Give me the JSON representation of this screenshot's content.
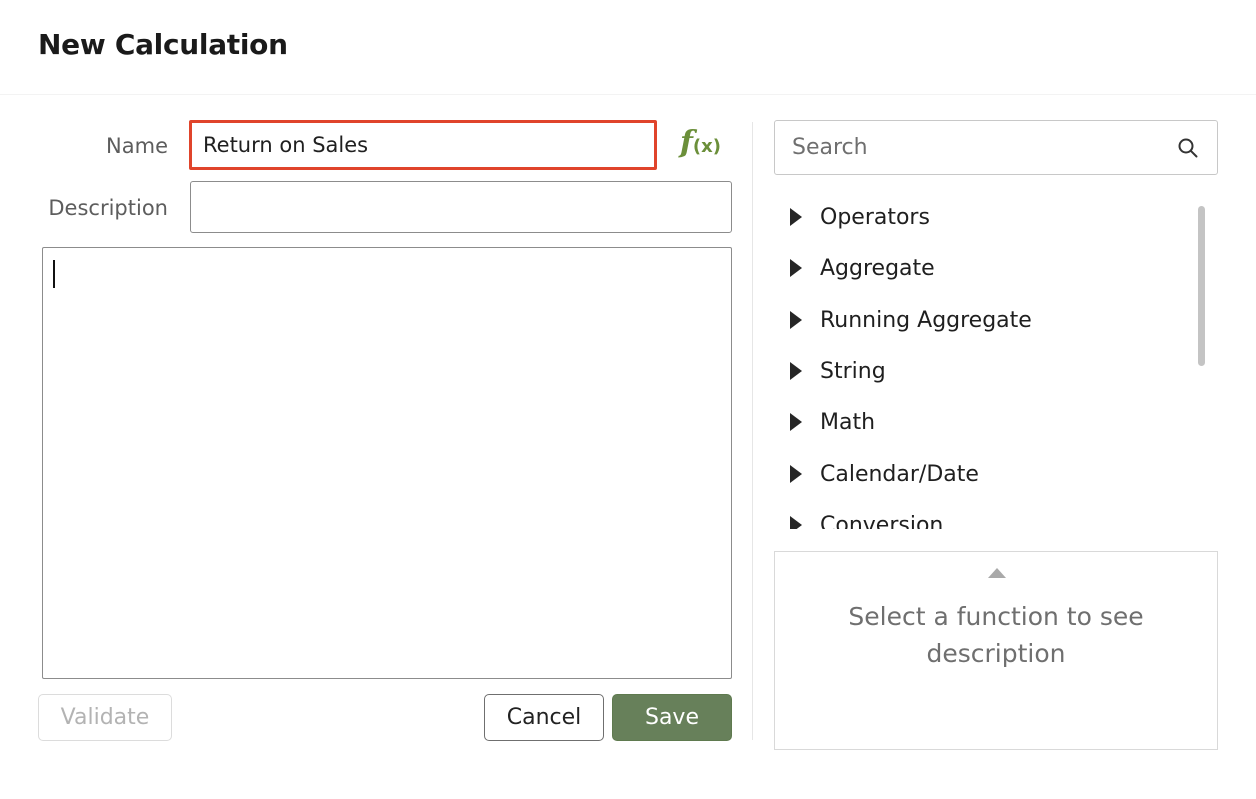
{
  "dialog": {
    "title": "New Calculation"
  },
  "form": {
    "name_label": "Name",
    "name_value": "Return on Sales",
    "description_label": "Description",
    "description_value": "",
    "fx_symbol": "f",
    "fx_args": "(x)",
    "fx_color": "#6b8f3a"
  },
  "buttons": {
    "validate": "Validate",
    "cancel": "Cancel",
    "save": "Save",
    "save_color": "#67805a"
  },
  "search": {
    "placeholder": "Search",
    "icon": "search-icon"
  },
  "function_categories": [
    {
      "label": "Operators"
    },
    {
      "label": "Aggregate"
    },
    {
      "label": "Running Aggregate"
    },
    {
      "label": "String"
    },
    {
      "label": "Math"
    },
    {
      "label": "Calendar/Date"
    },
    {
      "label": "Conversion"
    }
  ],
  "description_panel": {
    "text": "Select a function to see description"
  },
  "highlight_color": "#e0442b"
}
